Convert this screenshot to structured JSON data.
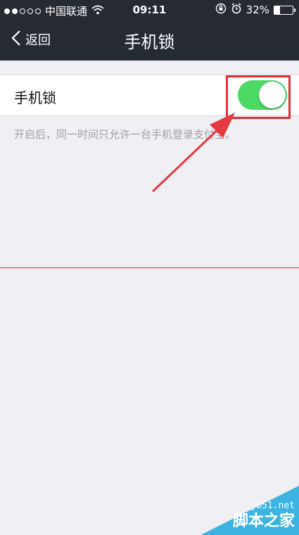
{
  "status_bar": {
    "carrier": "中国联通",
    "time": "09:11",
    "battery_percent": "32%",
    "battery_level": 0.32,
    "signal_filled": 2,
    "signal_total": 5
  },
  "nav": {
    "back_label": "返回",
    "title": "手机锁"
  },
  "setting": {
    "label": "手机锁",
    "toggle_on": true,
    "toggle_color": "#4cd964",
    "description": "开启后，同一时间只允许一台手机登录支付宝。"
  },
  "annotation": {
    "highlight_color": "#e03038"
  },
  "watermark": {
    "url": "jb51.net",
    "name": "脚本之家",
    "color": "#3cb3e0"
  }
}
